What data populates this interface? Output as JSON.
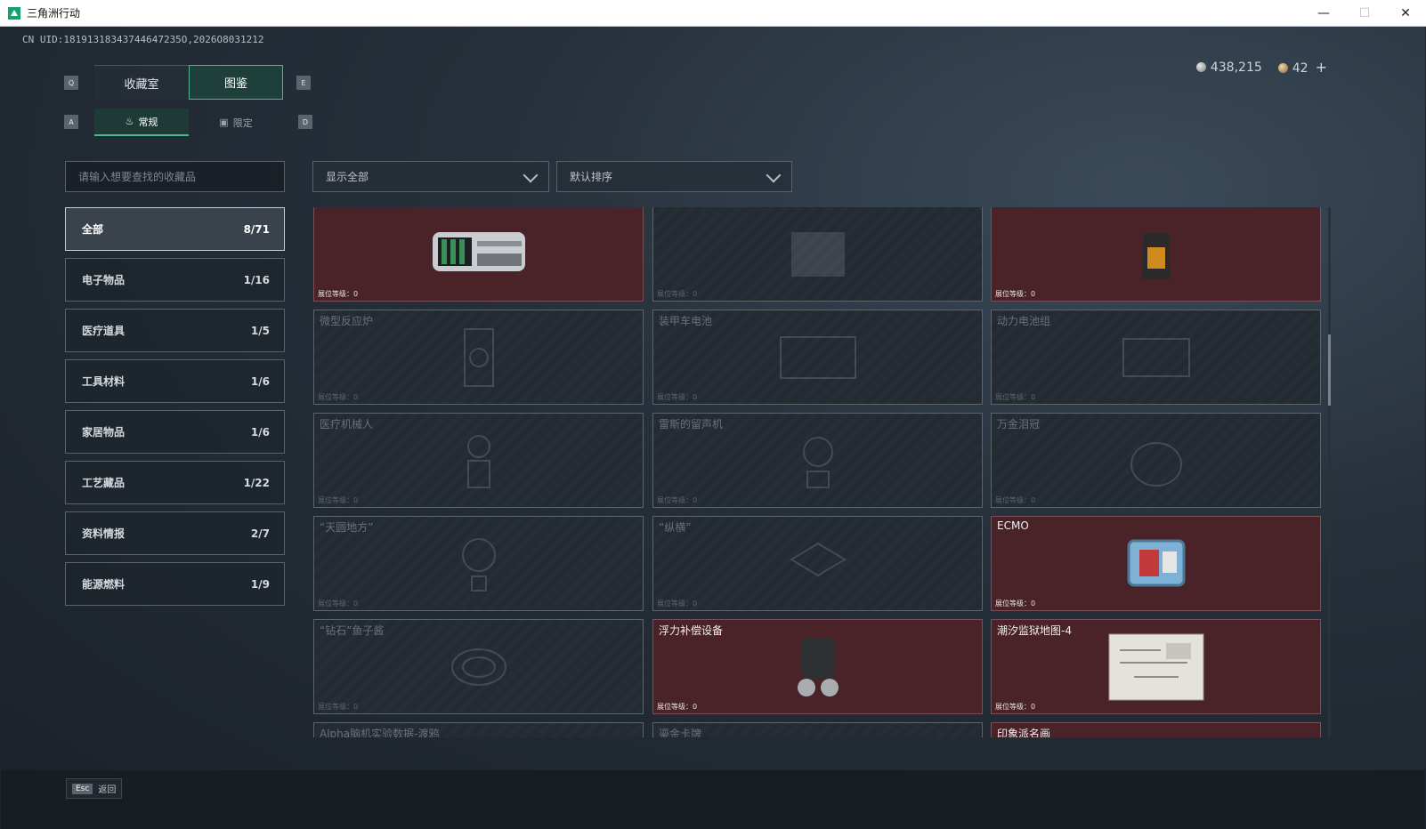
{
  "window": {
    "title": "三角洲行动",
    "controls": [
      "—",
      "☐",
      "✕"
    ]
  },
  "uid": "CN UID:18191318343744647235O,2026O8031212",
  "currency": {
    "silver": "438,215",
    "gold": "42",
    "plus": "+"
  },
  "keys": {
    "tab_left": "Q",
    "tab_right": "E",
    "sub_left": "A",
    "sub_right": "D"
  },
  "tabs": [
    {
      "label": "收藏室"
    },
    {
      "label": "图鉴"
    }
  ],
  "subtabs": [
    {
      "label": "常规",
      "icon": "flame-icon"
    },
    {
      "label": "限定",
      "icon": "image-icon"
    }
  ],
  "search": {
    "placeholder": "请输入想要查找的收藏品"
  },
  "filters": {
    "show": "显示全部",
    "sort": "默认排序"
  },
  "categories": [
    {
      "label": "全部",
      "count": "8/71"
    },
    {
      "label": "电子物品",
      "count": "1/16"
    },
    {
      "label": "医疗道具",
      "count": "1/5"
    },
    {
      "label": "工具材料",
      "count": "1/6"
    },
    {
      "label": "家居物品",
      "count": "1/6"
    },
    {
      "label": "工艺藏品",
      "count": "1/22"
    },
    {
      "label": "资料情报",
      "count": "2/7"
    },
    {
      "label": "能源燃料",
      "count": "1/9"
    }
  ],
  "level_label": "展位等级：",
  "items": [
    {
      "name": "",
      "owned": true,
      "level": "0",
      "icon": "gpu-icon"
    },
    {
      "name": "",
      "owned": false,
      "level": "0",
      "icon": "device-icon"
    },
    {
      "name": "",
      "owned": true,
      "level": "0",
      "icon": "coffee-bag-icon"
    },
    {
      "name": "微型反应炉",
      "owned": false,
      "level": "0",
      "icon": "reactor-icon"
    },
    {
      "name": "装甲车电池",
      "owned": false,
      "level": "0",
      "icon": "battery-icon"
    },
    {
      "name": "动力电池组",
      "owned": false,
      "level": "0",
      "icon": "battery-pack-icon"
    },
    {
      "name": "医疗机械人",
      "owned": false,
      "level": "0",
      "icon": "robot-icon"
    },
    {
      "name": "雷斯的留声机",
      "owned": false,
      "level": "0",
      "icon": "gramophone-icon"
    },
    {
      "name": "万金泪冠",
      "owned": false,
      "level": "0",
      "icon": "crown-icon"
    },
    {
      "name": "“天圆地方”",
      "owned": false,
      "level": "0",
      "icon": "globe-icon"
    },
    {
      "name": "“纵横”",
      "owned": false,
      "level": "0",
      "icon": "board-icon"
    },
    {
      "name": "ECMO",
      "owned": true,
      "level": "0",
      "icon": "ecmo-icon"
    },
    {
      "name": "“钻石”鱼子酱",
      "owned": false,
      "level": "0",
      "icon": "can-icon"
    },
    {
      "name": "浮力补偿设备",
      "owned": true,
      "level": "0",
      "icon": "bcd-icon"
    },
    {
      "name": "潮汐监狱地图-4",
      "owned": true,
      "level": "0",
      "icon": "map-icon"
    },
    {
      "name": "Alpha脑机实验数据-渡鸦",
      "owned": false,
      "level": "0",
      "icon": "data-icon"
    },
    {
      "name": "鎏金卡牌",
      "owned": false,
      "level": "0",
      "icon": "card-icon"
    },
    {
      "name": "印象派名画",
      "owned": true,
      "level": "0",
      "icon": "painting-icon"
    }
  ],
  "footer": {
    "key": "Esc",
    "label": "返回"
  }
}
